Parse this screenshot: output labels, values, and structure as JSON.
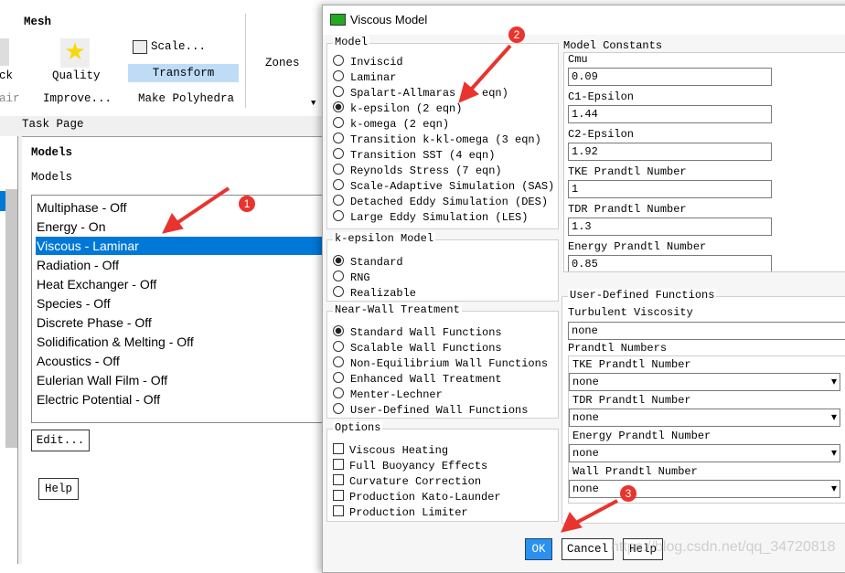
{
  "ribbon": {
    "group": "Mesh",
    "check": "ck",
    "repair": "air",
    "quality": "Quality",
    "improve": "Improve...",
    "scale": "Scale...",
    "transform": "Transform",
    "polyhedra": "Make Polyhedra",
    "zones": "Zones"
  },
  "task": {
    "title": "Task Page",
    "heading": "Models",
    "sub": "Models",
    "items": [
      "Multiphase - Off",
      "Energy - On",
      "Viscous - Laminar",
      "Radiation - Off",
      "Heat Exchanger - Off",
      "Species - Off",
      "Discrete Phase - Off",
      "Solidification & Melting - Off",
      "Acoustics - Off",
      "Eulerian Wall Film - Off",
      "Electric Potential - Off"
    ],
    "selected": 2,
    "edit": "Edit...",
    "help": "Help",
    "accent": "#0078d7"
  },
  "dialog": {
    "title": "Viscous Model",
    "model": {
      "title": "Model",
      "options": [
        "Inviscid",
        "Laminar",
        "Spalart-Allmaras (1 eqn)",
        "k-epsilon (2 eqn)",
        "k-omega (2 eqn)",
        "Transition k-kl-omega (3 eqn)",
        "Transition SST (4 eqn)",
        "Reynolds Stress (7 eqn)",
        "Scale-Adaptive Simulation (SAS)",
        "Detached Eddy Simulation (DES)",
        "Large Eddy Simulation (LES)"
      ],
      "selected": 3
    },
    "ke": {
      "title": "k-epsilon Model",
      "options": [
        "Standard",
        "RNG",
        "Realizable"
      ],
      "selected": 0
    },
    "wall": {
      "title": "Near-Wall Treatment",
      "options": [
        "Standard Wall Functions",
        "Scalable Wall Functions",
        "Non-Equilibrium Wall Functions",
        "Enhanced Wall Treatment",
        "Menter-Lechner",
        "User-Defined Wall Functions"
      ],
      "selected": 0
    },
    "opts": {
      "title": "Options",
      "items": [
        "Viscous Heating",
        "Full Buoyancy Effects",
        "Curvature Correction",
        "Production Kato-Launder",
        "Production Limiter"
      ]
    },
    "constants": {
      "title": "Model Constants",
      "items": [
        {
          "label": "Cmu",
          "value": "0.09"
        },
        {
          "label": "C1-Epsilon",
          "value": "1.44"
        },
        {
          "label": "C2-Epsilon",
          "value": "1.92"
        },
        {
          "label": "TKE Prandtl Number",
          "value": "1"
        },
        {
          "label": "TDR Prandtl Number",
          "value": "1.3"
        },
        {
          "label": "Energy Prandtl Number",
          "value": "0.85"
        }
      ]
    },
    "udf": {
      "title": "User-Defined Functions",
      "turb": "Turbulent Viscosity",
      "turb_val": "none",
      "prandtl": "Prandtl Numbers",
      "items": [
        {
          "label": "TKE Prandtl Number",
          "value": "none"
        },
        {
          "label": "TDR Prandtl Number",
          "value": "none"
        },
        {
          "label": "Energy Prandtl Number",
          "value": "none"
        },
        {
          "label": "Wall Prandtl Number",
          "value": "none"
        }
      ]
    },
    "ok": "OK",
    "cancel": "Cancel",
    "help": "Help"
  },
  "annotations": [
    "1",
    "2",
    "3"
  ],
  "watermark": "https://blog.csdn.net/qq_34720818"
}
